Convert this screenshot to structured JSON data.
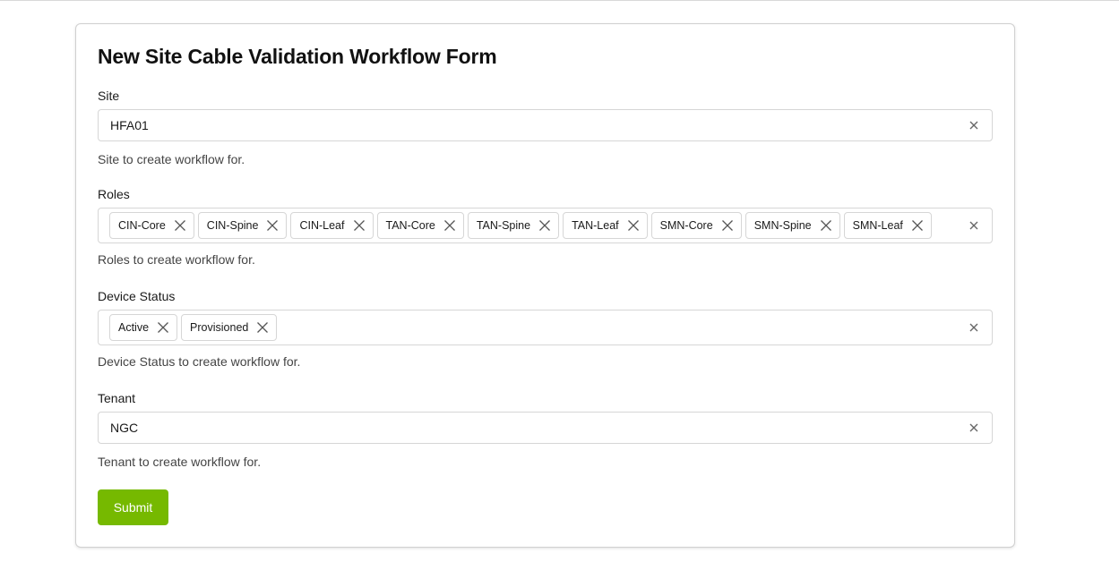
{
  "form": {
    "title": "New Site Cable Validation Workflow Form",
    "site": {
      "label": "Site",
      "value": "HFA01",
      "help": "Site to create workflow for."
    },
    "roles": {
      "label": "Roles",
      "values": [
        "CIN-Core",
        "CIN-Spine",
        "CIN-Leaf",
        "TAN-Core",
        "TAN-Spine",
        "TAN-Leaf",
        "SMN-Core",
        "SMN-Spine",
        "SMN-Leaf"
      ],
      "help": "Roles to create workflow for."
    },
    "device_status": {
      "label": "Device Status",
      "values": [
        "Active",
        "Provisioned"
      ],
      "help": "Device Status to create workflow for."
    },
    "tenant": {
      "label": "Tenant",
      "value": "NGC",
      "help": "Tenant to create workflow for."
    },
    "submit_label": "Submit"
  },
  "icons": {
    "clear": "close-icon",
    "chip_remove": "close-icon"
  },
  "colors": {
    "accent": "#76b900",
    "border": "#d6d6d6",
    "icon": "#666666"
  }
}
